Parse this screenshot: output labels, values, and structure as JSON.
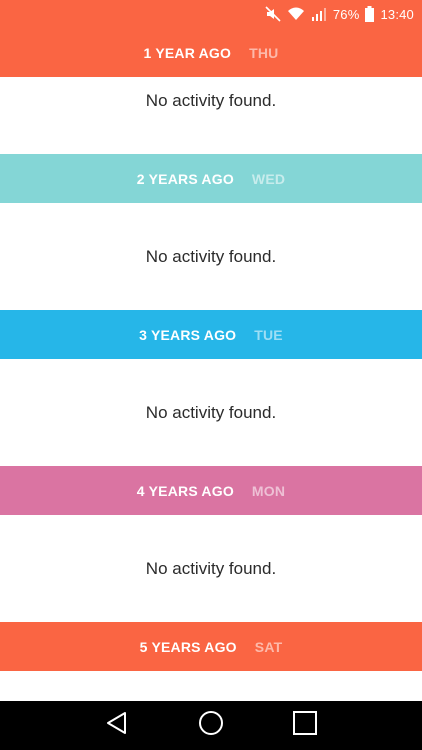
{
  "status_bar": {
    "battery": "76%",
    "time": "13:40",
    "icons": [
      "mute-icon",
      "wifi-icon",
      "signal-icon",
      "battery-icon"
    ]
  },
  "colors": {
    "coral": "#fa6543",
    "teal": "#84d6d6",
    "blue": "#26b6e8",
    "pink": "#da74a2"
  },
  "sections": [
    {
      "label": "1 YEAR AGO",
      "day": "THU",
      "color": "#fa6543",
      "message": "No activity found."
    },
    {
      "label": "2 YEARS AGO",
      "day": "WED",
      "color": "#84d6d6",
      "message": "No activity found."
    },
    {
      "label": "3 YEARS AGO",
      "day": "TUE",
      "color": "#26b6e8",
      "message": "No activity found."
    },
    {
      "label": "4 YEARS AGO",
      "day": "MON",
      "color": "#da74a2",
      "message": "No activity found."
    },
    {
      "label": "5 YEARS AGO",
      "day": "SAT",
      "color": "#fa6543"
    }
  ],
  "nav_bar": {
    "icons": [
      "back-icon",
      "home-icon",
      "recents-icon"
    ]
  }
}
